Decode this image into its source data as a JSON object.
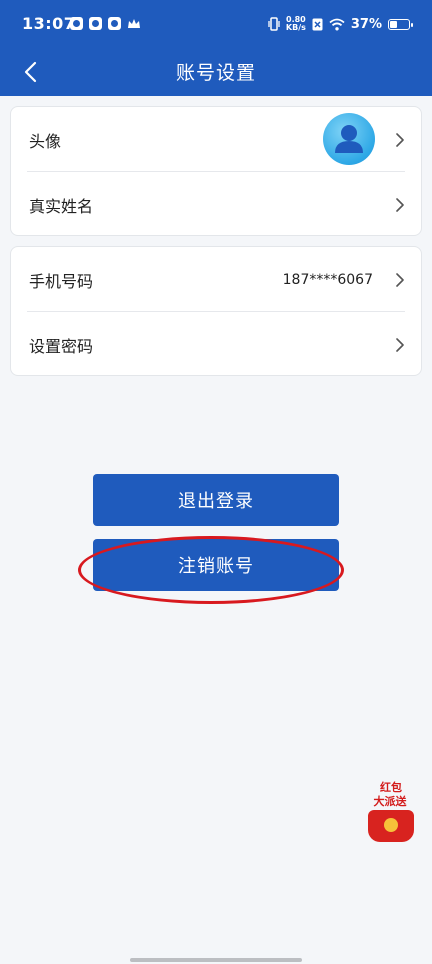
{
  "status_bar": {
    "time": "13:07",
    "net_speed_value": "0.80",
    "net_speed_unit": "KB/s",
    "battery_percent": "37%",
    "battery_level": 0.37
  },
  "header": {
    "title": "账号设置"
  },
  "card_profile": {
    "rows": [
      {
        "label": "头像"
      },
      {
        "label": "真实姓名"
      }
    ]
  },
  "card_account": {
    "rows": [
      {
        "label": "手机号码",
        "value": "187****6067"
      },
      {
        "label": "设置密码"
      }
    ]
  },
  "actions": {
    "logout_label": "退出登录",
    "cancel_account_label": "注销账号"
  },
  "promo": {
    "line1": "红包",
    "line2": "大派送"
  },
  "colors": {
    "primary": "#1f5bbd",
    "annotation": "#d8191f",
    "background": "#f4f6f9"
  },
  "icons": {
    "back": "chevron-left-icon",
    "row_arrow": "chevron-right-icon",
    "avatar": "user-avatar-icon"
  }
}
